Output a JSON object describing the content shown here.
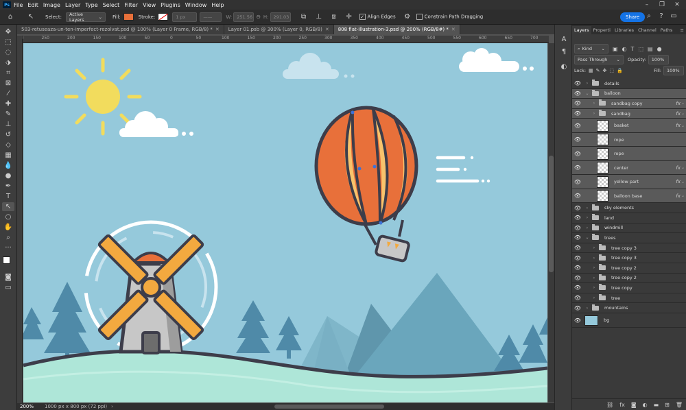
{
  "app": {
    "logo": "Ps"
  },
  "menu": [
    "File",
    "Edit",
    "Image",
    "Layer",
    "Type",
    "Select",
    "Filter",
    "View",
    "Plugins",
    "Window",
    "Help"
  ],
  "options": {
    "select_label": "Select:",
    "select_value": "Active Layers",
    "fill_label": "Fill:",
    "fill_color": "#e8703a",
    "stroke_label": "Stroke:",
    "stroke_width": "1 px",
    "w_label": "W:",
    "w_value": "251.56",
    "h_label": "H:",
    "h_value": "291.03",
    "align_edges": "Align Edges",
    "constrain": "Constrain Path Dragging",
    "share": "Share"
  },
  "tabs": [
    {
      "label": "503-retuseaza-un-ten-imperfect-rezolvat.psd @ 100% (Layer 0 Frame, RGB/8) *"
    },
    {
      "label": "Layer 01.psb @ 300% (Layer 0, RGB/8)"
    },
    {
      "label": "808 flat-illustration-3.psd @ 200% (RGB/8#) *"
    }
  ],
  "ruler": [
    "550",
    "250",
    "200",
    "150",
    "100",
    "50",
    "0",
    "50",
    "100",
    "150",
    "200",
    "250",
    "300",
    "350",
    "400",
    "450",
    "500",
    "550",
    "600",
    "650",
    "700",
    "750",
    "800",
    "850",
    "900"
  ],
  "status": {
    "zoom": "200%",
    "doc_info": "1000 px x 800 px (72 ppi)"
  },
  "panel": {
    "tabs": [
      "Layers",
      "Properti",
      "Libraries",
      "Channel",
      "Paths"
    ],
    "kind": "Kind",
    "blend": "Pass Through",
    "opacity_label": "Opacity:",
    "opacity": "100%",
    "lock_label": "Lock:",
    "fill_label": "Fill:",
    "fill": "100%"
  },
  "layers": [
    {
      "name": "details",
      "type": "group",
      "indent": 0,
      "open": false,
      "sel": false,
      "fx": false
    },
    {
      "name": "balloon",
      "type": "group",
      "indent": 0,
      "open": true,
      "sel": true,
      "fx": false
    },
    {
      "name": "sandbag copy",
      "type": "group",
      "indent": 1,
      "open": false,
      "sel": true,
      "fx": true
    },
    {
      "name": "sandbag",
      "type": "group",
      "indent": 1,
      "open": false,
      "sel": true,
      "fx": true
    },
    {
      "name": "basket",
      "type": "layer",
      "indent": 1,
      "sel": true,
      "fx": true
    },
    {
      "name": "rope",
      "type": "layer",
      "indent": 1,
      "sel": true,
      "fx": false
    },
    {
      "name": "rope",
      "type": "layer",
      "indent": 1,
      "sel": true,
      "fx": false
    },
    {
      "name": "center",
      "type": "layer",
      "indent": 1,
      "sel": true,
      "fx": true
    },
    {
      "name": "yellow part",
      "type": "layer",
      "indent": 1,
      "sel": true,
      "fx": true
    },
    {
      "name": "balloon base",
      "type": "layer",
      "indent": 1,
      "sel": true,
      "fx": true
    },
    {
      "name": "sky elements",
      "type": "group",
      "indent": 0,
      "open": false,
      "sel": false,
      "fx": false
    },
    {
      "name": "land",
      "type": "group",
      "indent": 0,
      "open": false,
      "sel": false,
      "fx": false
    },
    {
      "name": "windmill",
      "type": "group",
      "indent": 0,
      "open": false,
      "sel": false,
      "fx": false
    },
    {
      "name": "trees",
      "type": "group",
      "indent": 0,
      "open": true,
      "sel": false,
      "fx": false
    },
    {
      "name": "tree copy 3",
      "type": "group",
      "indent": 1,
      "open": false,
      "sel": false,
      "fx": false
    },
    {
      "name": "tree copy 3",
      "type": "group",
      "indent": 1,
      "open": false,
      "sel": false,
      "fx": false
    },
    {
      "name": "tree copy 2",
      "type": "group",
      "indent": 1,
      "open": false,
      "sel": false,
      "fx": false
    },
    {
      "name": "tree copy 2",
      "type": "group",
      "indent": 1,
      "open": false,
      "sel": false,
      "fx": false
    },
    {
      "name": "tree copy",
      "type": "group",
      "indent": 1,
      "open": false,
      "sel": false,
      "fx": false
    },
    {
      "name": "tree",
      "type": "group",
      "indent": 1,
      "open": false,
      "sel": false,
      "fx": false
    },
    {
      "name": "mountains",
      "type": "group",
      "indent": 0,
      "open": false,
      "sel": false,
      "fx": false
    },
    {
      "name": "bg",
      "type": "bg",
      "indent": 0,
      "sel": false,
      "fx": false
    }
  ],
  "colors": {
    "sky": "#95c9db",
    "balloon_orange": "#e8703a",
    "balloon_yellow": "#f8c36c",
    "sun": "#f2dc5d",
    "outline": "#3d3d4a",
    "tree": "#4f8aa8",
    "mountain": "#6aa6bc",
    "ground": "#aee6d8",
    "accent": "#1473e6"
  }
}
